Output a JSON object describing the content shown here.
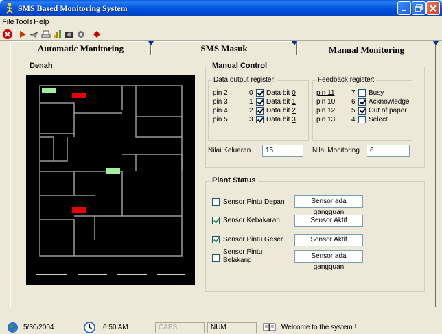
{
  "window": {
    "title": "SMS Based Monitoring System"
  },
  "menu": {
    "items": [
      "File",
      "Tools",
      "Help"
    ]
  },
  "tabs": [
    "Automatic Monitoring",
    "SMS Masuk",
    "Manual Monitoring"
  ],
  "denah": {
    "title": "Denah"
  },
  "manual_control": {
    "title": "Manual Control",
    "output_register": {
      "title": "Data output register:",
      "rows": [
        {
          "pin": "pin 2",
          "num": "0",
          "checked": true,
          "label_pre": "Data bit ",
          "label_key": "0"
        },
        {
          "pin": "pin 3",
          "num": "1",
          "checked": true,
          "label_pre": "Data bit ",
          "label_key": "1"
        },
        {
          "pin": "pin 4",
          "num": "2",
          "checked": true,
          "label_pre": "Data bit ",
          "label_key": "2"
        },
        {
          "pin": "pin 5",
          "num": "3",
          "checked": true,
          "label_pre": "Data bit ",
          "label_key": "3"
        }
      ]
    },
    "feedback_register": {
      "title": "Feedback register:",
      "rows": [
        {
          "pin": "pin 11",
          "num": "7",
          "checked": false,
          "label": "Busy"
        },
        {
          "pin": "pin 10",
          "num": "6",
          "checked": true,
          "label": "Acknowledge"
        },
        {
          "pin": "pin 12",
          "num": "5",
          "checked": true,
          "label": "Out of paper"
        },
        {
          "pin": "pin 13",
          "num": "4",
          "checked": false,
          "label": "Select"
        }
      ]
    },
    "nilai_keluaran": {
      "label": "Nilai Keluaran",
      "value": "15"
    },
    "nilai_monitoring": {
      "label": "Nilai Monitoring",
      "value": "6"
    }
  },
  "plant_status": {
    "title": "Plant Status",
    "sensors": [
      {
        "label": "Sensor Pintu Depan",
        "checked": false,
        "status": "Sensor ada gangguan"
      },
      {
        "label": "Sensor Kebakaran",
        "checked": true,
        "status": "Sensor Aktif"
      },
      {
        "label": "Sensor Pintu Geser",
        "checked": true,
        "status": "Sensor Aktif"
      },
      {
        "label_line1": "Sensor Pintu",
        "label_line2": "Belakang",
        "checked": false,
        "status": "Sensor ada gangguan"
      }
    ]
  },
  "statusbar": {
    "date": "5/30/2004",
    "time": "6:50 AM",
    "caps": "CAPS",
    "num": "NUM",
    "message": "Welcome to the system !"
  },
  "colors": {
    "sensor_green": "#a0f0a0",
    "sensor_red": "#e60000",
    "titlebar": "#0054e3"
  }
}
